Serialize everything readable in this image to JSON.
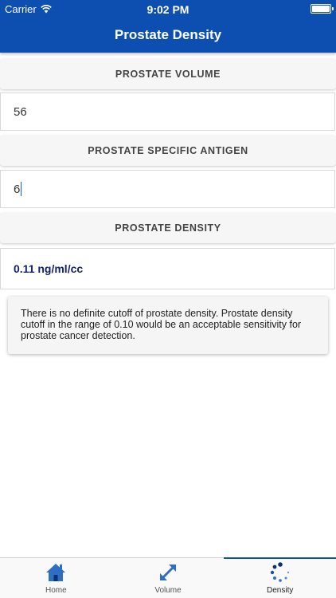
{
  "status_bar": {
    "carrier": "Carrier",
    "time": "9:02 PM"
  },
  "nav": {
    "title": "Prostate Density"
  },
  "volume": {
    "header": "PROSTATE VOLUME",
    "value": "56"
  },
  "psa": {
    "header": "PROSTATE SPECIFIC ANTIGEN",
    "value": "6"
  },
  "density": {
    "header": "PROSTATE DENSITY",
    "result": "0.11 ng/ml/cc"
  },
  "note": {
    "text": "There is no definite cutoff of prostate density. Prostate density cutoff in the range of 0.10 would be an acceptable sensitivity for prostate cancer detection."
  },
  "tabs": [
    {
      "label": "Home",
      "icon": "home-icon"
    },
    {
      "label": "Volume",
      "icon": "expand-arrows-icon"
    },
    {
      "label": "Density",
      "icon": "dotted-spinner-icon",
      "active": true
    }
  ],
  "colors": {
    "primary": "#0d4fb0",
    "result_text": "#14236b",
    "icon_blue": "#2f6fc1",
    "icon_dark": "#0b2f7a"
  }
}
